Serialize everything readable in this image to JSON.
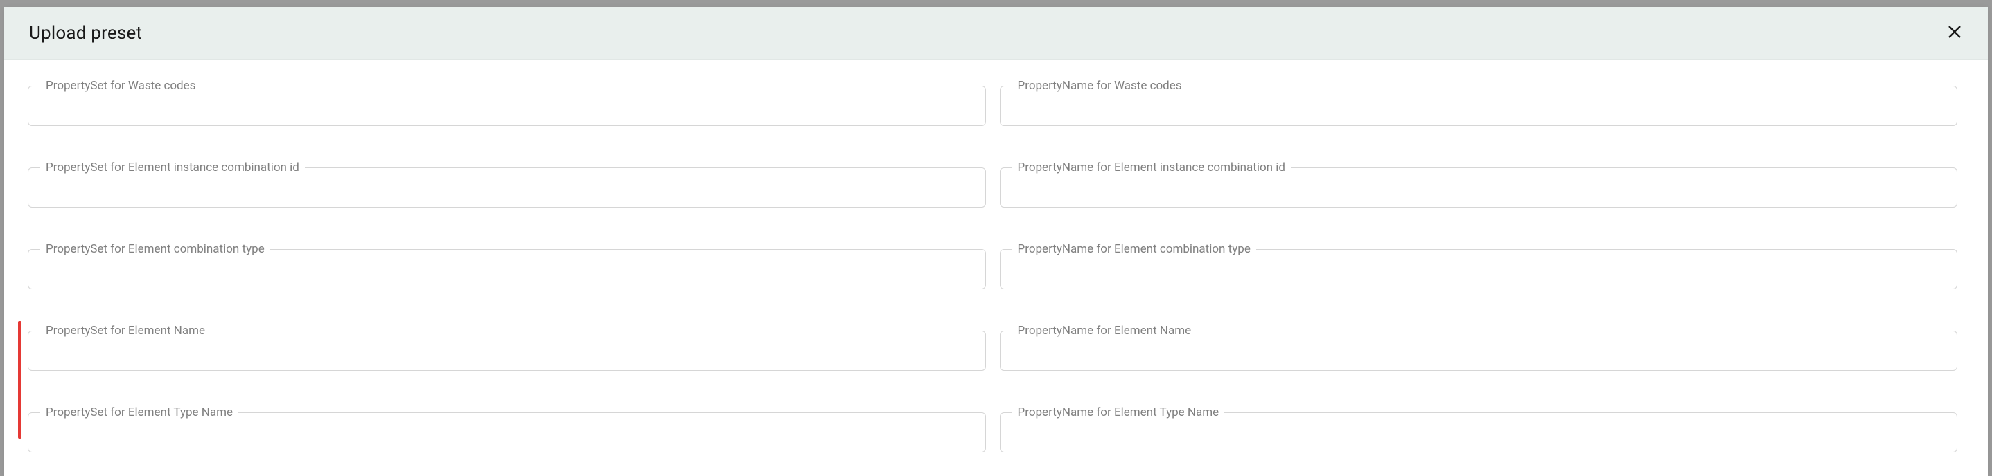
{
  "header": {
    "title": "Upload preset"
  },
  "rows": [
    {
      "set_label": "PropertySet for Waste codes",
      "name_label": "PropertyName for Waste codes",
      "set_value": "",
      "name_value": "",
      "marked": false
    },
    {
      "set_label": "PropertySet for Element instance combination id",
      "name_label": "PropertyName for Element instance combination id",
      "set_value": "",
      "name_value": "",
      "marked": false
    },
    {
      "set_label": "PropertySet for Element combination type",
      "name_label": "PropertyName for Element combination type",
      "set_value": "",
      "name_value": "",
      "marked": false
    },
    {
      "set_label": "PropertySet for Element Name",
      "name_label": "PropertyName for Element Name",
      "set_value": "",
      "name_value": "",
      "marked": true
    },
    {
      "set_label": "PropertySet for Element Type Name",
      "name_label": "PropertyName for Element Type Name",
      "set_value": "",
      "name_value": "",
      "marked": true
    }
  ]
}
